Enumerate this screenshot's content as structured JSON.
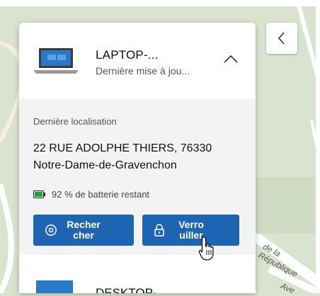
{
  "device": {
    "name": "LAPTOP-...",
    "status": "Dernière mise à jou..."
  },
  "details": {
    "location_label": "Dernière localisation",
    "address_line1": "22 RUE ADOLPHE THIERS, 76330",
    "address_line2": "Notre-Dame-de-Gravenchon",
    "battery_text": "92 % de batterie restant"
  },
  "actions": {
    "find_label_line1": "Recher",
    "find_label_line2": "cher",
    "lock_label_line1": "Verro",
    "lock_label_line2": "uiller"
  },
  "next_device": {
    "name": "DESKTOP-..."
  },
  "map": {
    "road_label": "de la République",
    "road_label_2": "Ave"
  },
  "icons": {
    "back": "chevron-left-icon",
    "collapse": "chevron-up-icon",
    "find": "location-pin-icon",
    "lock": "lock-icon",
    "battery": "battery-icon",
    "laptop": "laptop-icon",
    "desktop": "desktop-icon",
    "cursor": "hand-pointer-icon"
  },
  "colors": {
    "accent": "#1d64b3",
    "battery_green": "#1f9e3c",
    "map_bg": "#d9e3cf",
    "device_blue": "#2b78c8"
  }
}
